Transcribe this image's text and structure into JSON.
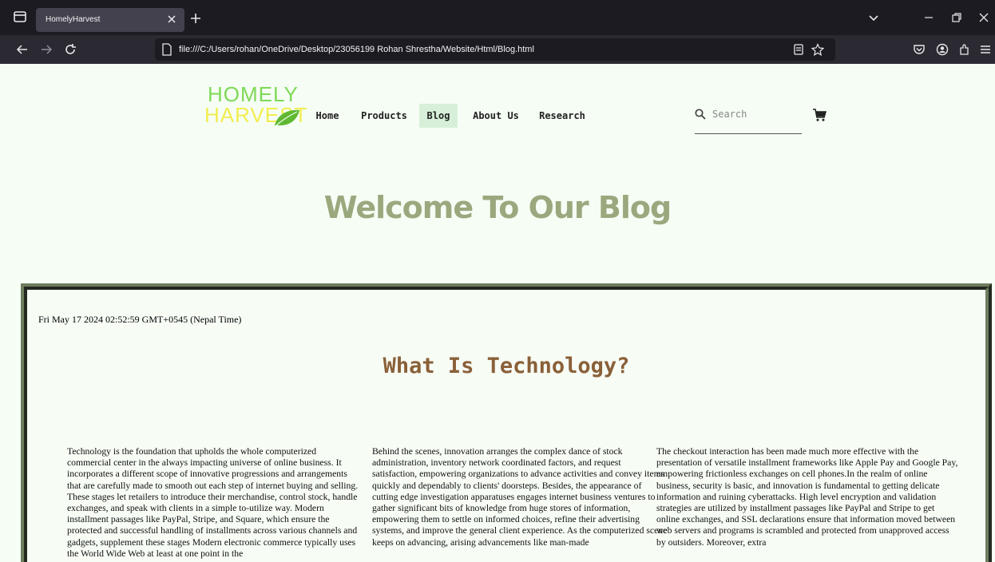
{
  "browser": {
    "tab_title": "HomelyHarvest",
    "url": "file:///C:/Users/rohan/OneDrive/Desktop/23056199 Rohan Shrestha/Website/Html/Blog.html",
    "icons": [
      "tab-list-icon",
      "close-icon",
      "plus-icon",
      "chevron-down-icon",
      "minimize-icon",
      "restore-icon",
      "back-icon",
      "forward-icon",
      "reload-icon",
      "page-icon",
      "reader-view-icon",
      "bookmark-star-icon",
      "pocket-icon",
      "account-icon",
      "extensions-icon",
      "menu-icon"
    ]
  },
  "site": {
    "logo_line1": "HOMELY",
    "logo_line2": "HARVEST",
    "nav": [
      {
        "label": "Home"
      },
      {
        "label": "Products"
      },
      {
        "label": "Blog"
      },
      {
        "label": "About Us"
      },
      {
        "label": "Research"
      }
    ],
    "active_nav": "Blog",
    "search_placeholder": "Search",
    "heading": "Welcome To Our Blog"
  },
  "blog": {
    "date": "Fri May 17 2024 02:52:59 GMT+0545 (Nepal Time)",
    "title": "What Is Technology?",
    "columns": [
      "Technology is the foundation that upholds the whole computerized commercial center in the always impacting universe of online business. It incorporates a different scope of innovative progressions and arrangements that are carefully made to smooth out each step of internet buying and selling. These stages let retailers to introduce their merchandise, control stock, handle exchanges, and speak with clients in a simple to-utilize way. Modern installment passages like PayPal, Stripe, and Square, which ensure the protected and successful handling of installments across various channels and gadgets, supplement these stages Modern electronic commerce typically uses the World Wide Web at least at one point in the",
      "Behind the scenes, innovation arranges the complex dance of stock administration, inventory network coordinated factors, and request satisfaction, empowering organizations to advance activities and convey items quickly and dependably to clients' doorsteps. Besides, the appearance of cutting edge investigation apparatuses engages internet business ventures to gather significant bits of knowledge from huge stores of information, empowering them to settle on informed choices, refine their advertising systems, and improve the general client experience. As the computerized scene keeps on advancing, arising advancements like man-made",
      "The checkout interaction has been made much more effective with the presentation of versatile installment frameworks like Apple Pay and Google Pay, empowering frictionless exchanges on cell phones.In the realm of online business, security is basic, and innovation is fundamental to getting delicate information and ruining cyberattacks. High level encryption and validation strategies are utilized by installment passages like PayPal and Stripe to get online exchanges, and SSL declarations ensure that information moved between web servers and programs is scrambled and protected from unapproved access by outsiders. Moreover, extra"
    ]
  },
  "colors": {
    "chrome_dark": "#1c1b22",
    "toolbar": "#2b2a33",
    "page_bg": "#f5fdf4",
    "heading": "#9aa87e",
    "blog_title": "#8a6038",
    "nav_active_bg": "#d7efd8",
    "logo_green": "#7ed957",
    "logo_yellow": "#f2ed50"
  }
}
